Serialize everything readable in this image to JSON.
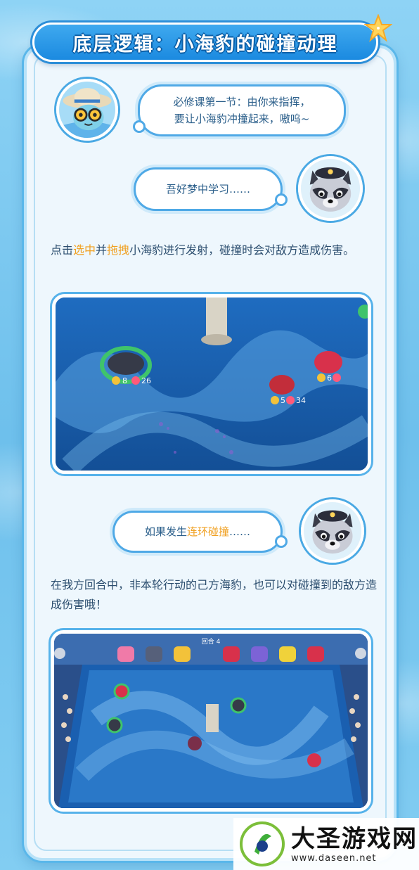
{
  "title": "底层逻辑：小海豹的碰撞动理",
  "dialog1": {
    "line1": "必修课第一节：由你来指挥，",
    "line2": "要让小海豹冲撞起来，嗷呜~"
  },
  "dialog2": {
    "text": "吾好梦中学习……"
  },
  "para1": {
    "pre": "点击",
    "hl1": "选中",
    "mid": "并",
    "hl2": "拖拽",
    "post": "小海豹进行发射，碰撞时会对敌方造成伤害。"
  },
  "game1": {
    "unit_left": {
      "atk": "8",
      "hp": "26"
    },
    "unit_mid": {
      "atk": "5",
      "hp": "34"
    },
    "unit_right": {
      "atk": "6",
      "hp": ""
    }
  },
  "dialog3": {
    "pre": "如果发生",
    "hl": "连环碰撞",
    "post": "……"
  },
  "para2": {
    "text": "在我方回合中，非本轮行动的己方海豹，也可以对碰撞到的敌方造成伤害哦！"
  },
  "game2": {
    "turn_label": "回合 4"
  },
  "watermark": {
    "title": "大圣游戏网",
    "url": "www.daseen.net"
  },
  "colors": {
    "primary": "#2c8ed8",
    "highlight": "#f0a021",
    "text": "#2b4d6e"
  }
}
